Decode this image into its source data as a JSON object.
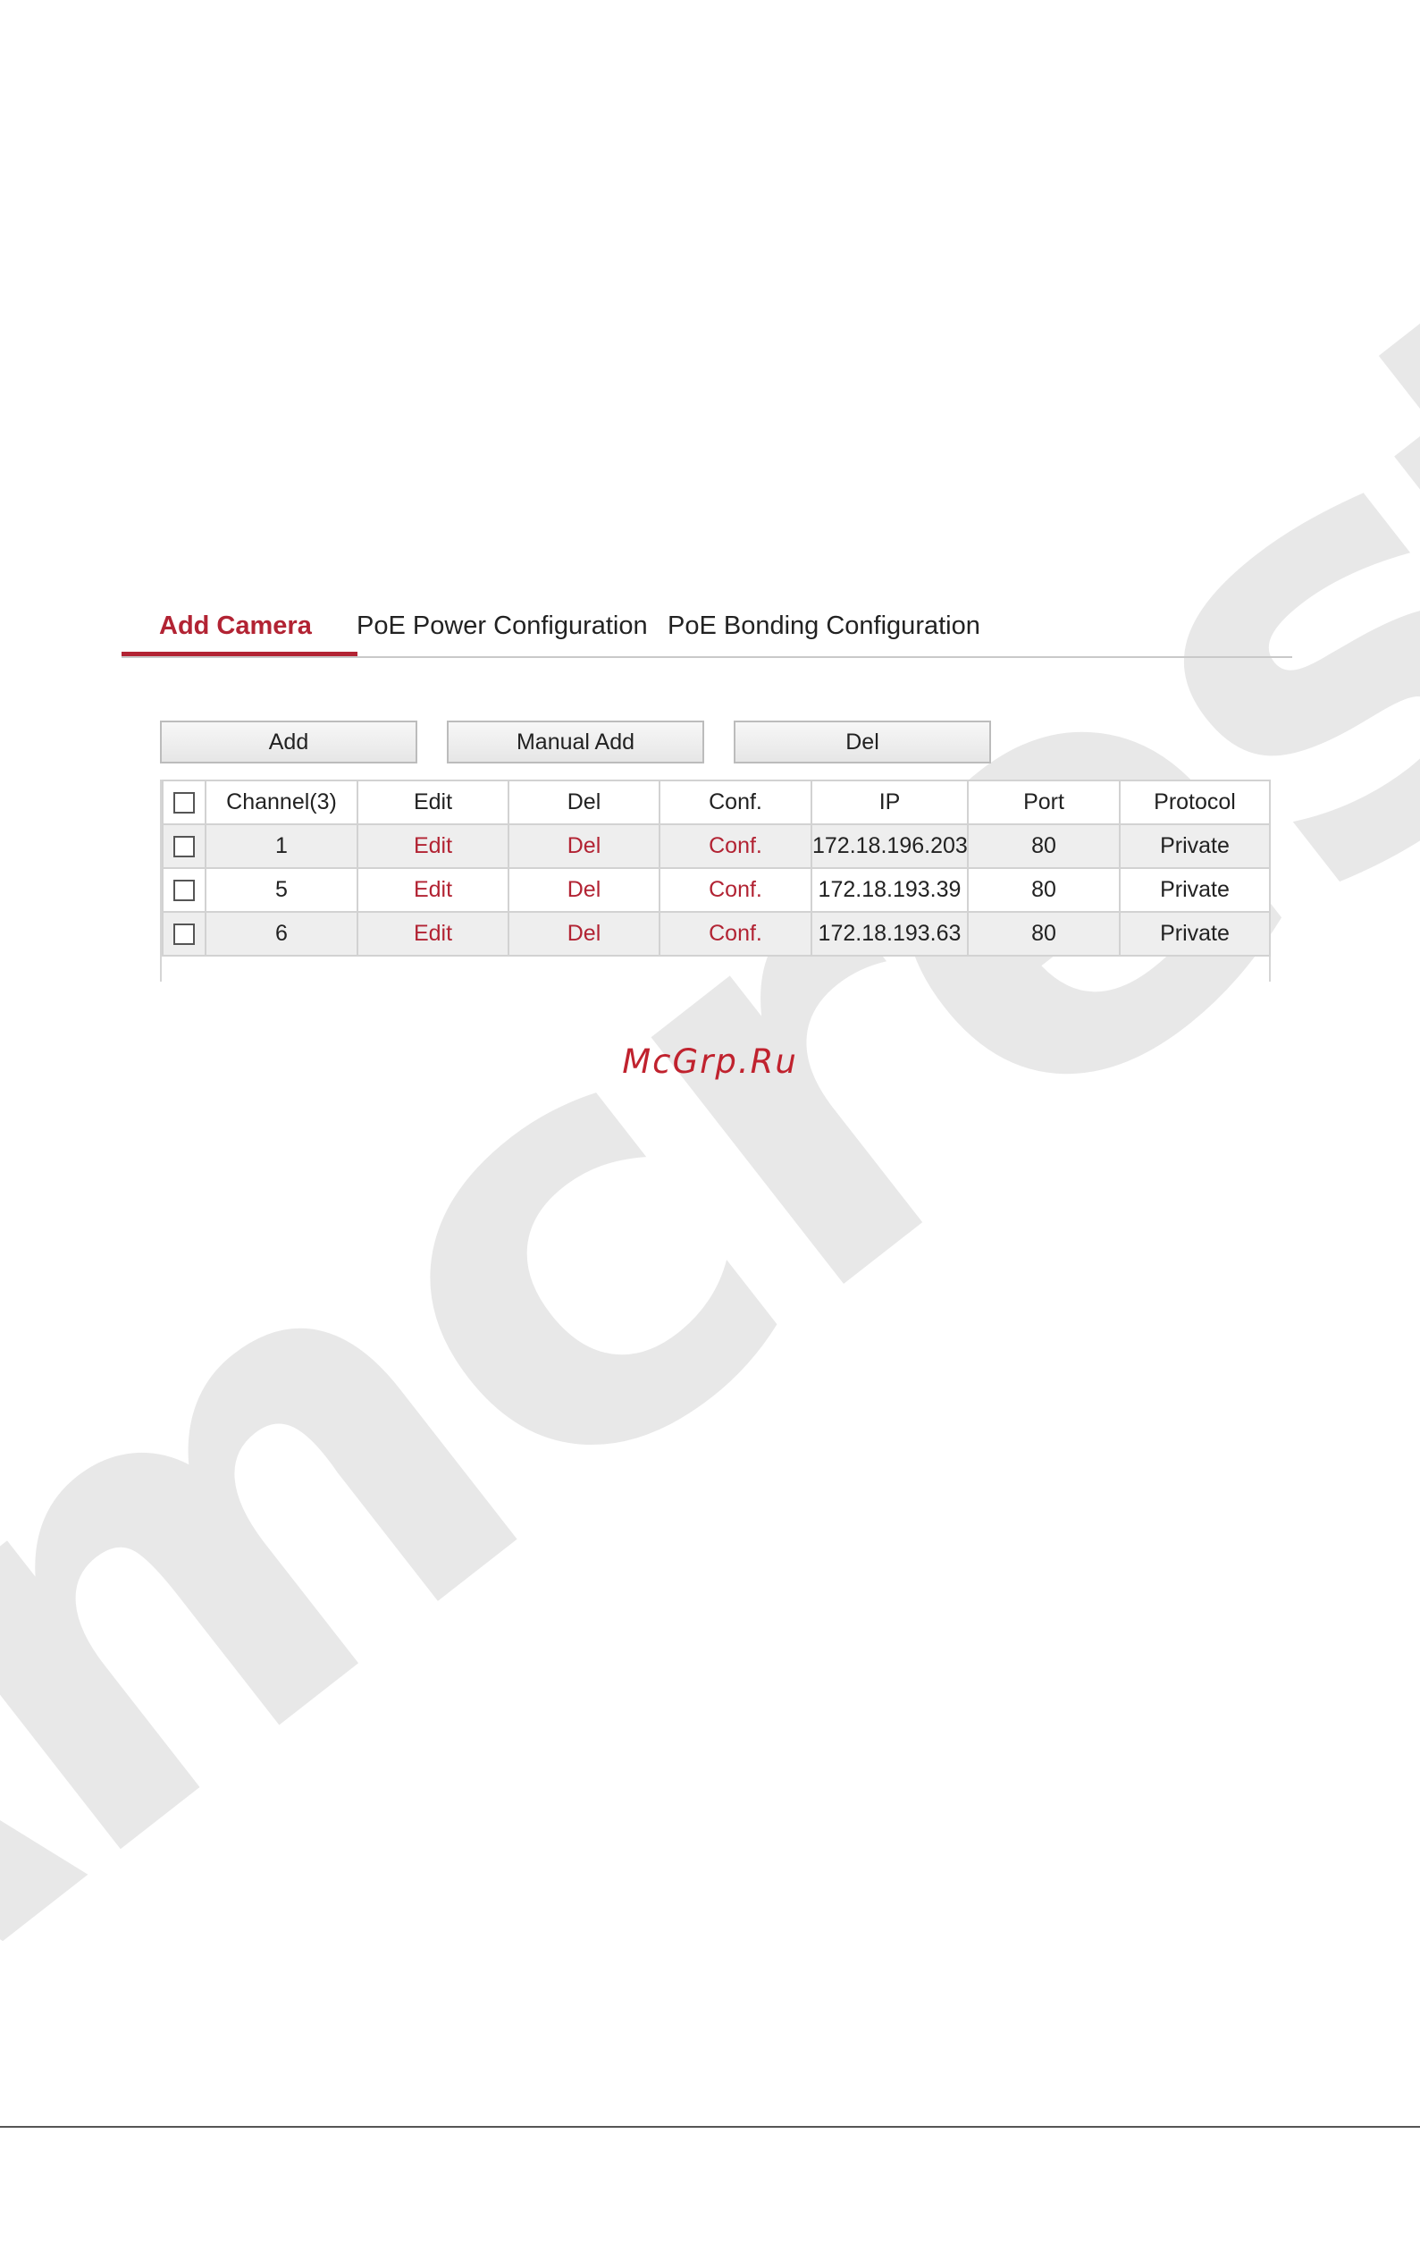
{
  "watermark": "Amcrest",
  "tabs": [
    {
      "label": "Add Camera",
      "active": true
    },
    {
      "label": "PoE Power Configuration",
      "active": false
    },
    {
      "label": "PoE Bonding Configuration",
      "active": false
    }
  ],
  "buttons": {
    "add": "Add",
    "manual_add": "Manual Add",
    "del": "Del"
  },
  "table": {
    "headers": [
      "Channel(3)",
      "Edit",
      "Del",
      "Conf.",
      "IP",
      "Port",
      "Protocol"
    ],
    "rows": [
      {
        "channel": "1",
        "edit": "Edit",
        "del": "Del",
        "conf": "Conf.",
        "ip": "172.18.196.203",
        "port": "80",
        "protocol": "Private"
      },
      {
        "channel": "5",
        "edit": "Edit",
        "del": "Del",
        "conf": "Conf.",
        "ip": "172.18.193.39",
        "port": "80",
        "protocol": "Private"
      },
      {
        "channel": "6",
        "edit": "Edit",
        "del": "Del",
        "conf": "Conf.",
        "ip": "172.18.193.63",
        "port": "80",
        "protocol": "Private"
      }
    ]
  },
  "site_mark": "McGrp.Ru",
  "colors": {
    "accent": "#b22333",
    "row_alt": "#eeeeee",
    "border": "#d2d2d2"
  }
}
